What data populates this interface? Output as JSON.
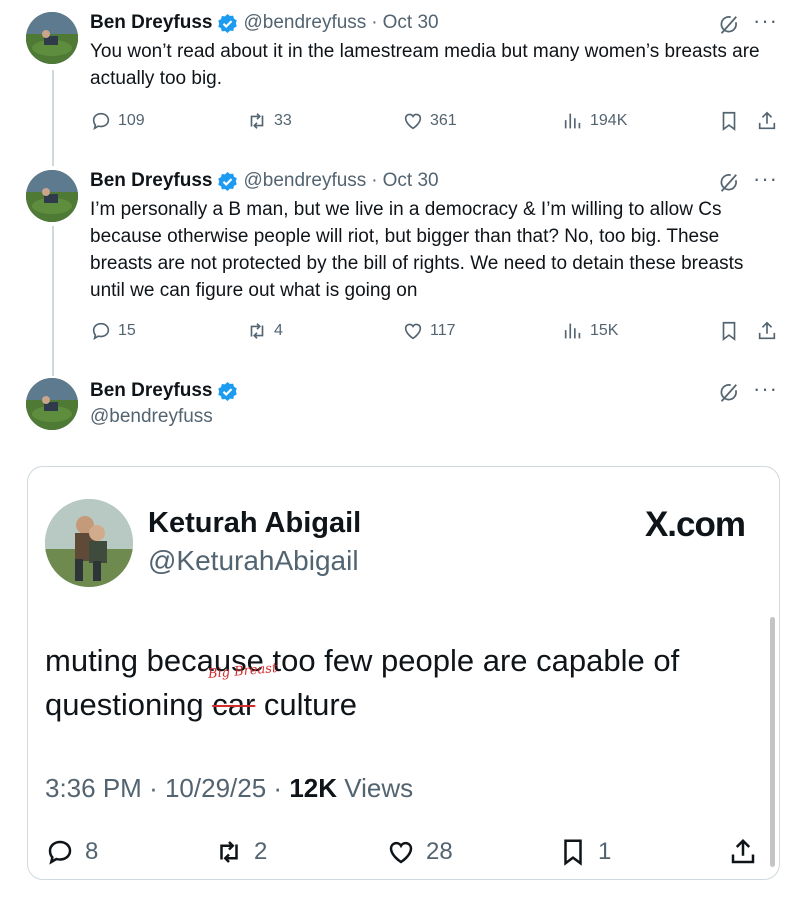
{
  "tweets": [
    {
      "name": "Ben Dreyfuss",
      "handle": "@bendreyfuss",
      "date": "Oct 30",
      "text": "You won’t read about it in the lamestream media but many women’s breasts are actually too big.",
      "replies": "109",
      "reposts": "33",
      "likes": "361",
      "views": "194K"
    },
    {
      "name": "Ben Dreyfuss",
      "handle": "@bendreyfuss",
      "date": "Oct 30",
      "text": "I’m personally a B man, but we live in a democracy & I’m willing to allow Cs because otherwise people will riot, but bigger than that? No, too big. These breasts are not protected by the bill of rights. We need to detain these breasts until we can figure out what is going on",
      "replies": "15",
      "reposts": "4",
      "likes": "117",
      "views": "15K"
    },
    {
      "name": "Ben Dreyfuss",
      "handle": "@bendreyfuss"
    }
  ],
  "separator": "·",
  "more_label": "···",
  "icons": {
    "reply": "reply-icon",
    "repost": "repost-icon",
    "like": "heart-icon",
    "views": "views-chart-icon",
    "bookmark": "bookmark-icon",
    "share": "share-icon",
    "grok": "grok-icon",
    "verified": "verified-badge-icon"
  },
  "colors": {
    "verified": "#1d9bf0",
    "secondary_text": "#536471",
    "annotation": "#d62b2b"
  },
  "embedded": {
    "name": "Keturah Abigail",
    "handle": "@KeturahAbigail",
    "brand": "X.com",
    "text_before": "muting because too few people are capable of questioning",
    "struck_word": "car",
    "annotation": "Big Breast",
    "text_after": "culture",
    "time": "3:36 PM",
    "date": "10/29/25",
    "views_count": "12K",
    "views_label": "Views",
    "replies": "8",
    "reposts": "2",
    "likes": "28",
    "bookmarks": "1"
  }
}
